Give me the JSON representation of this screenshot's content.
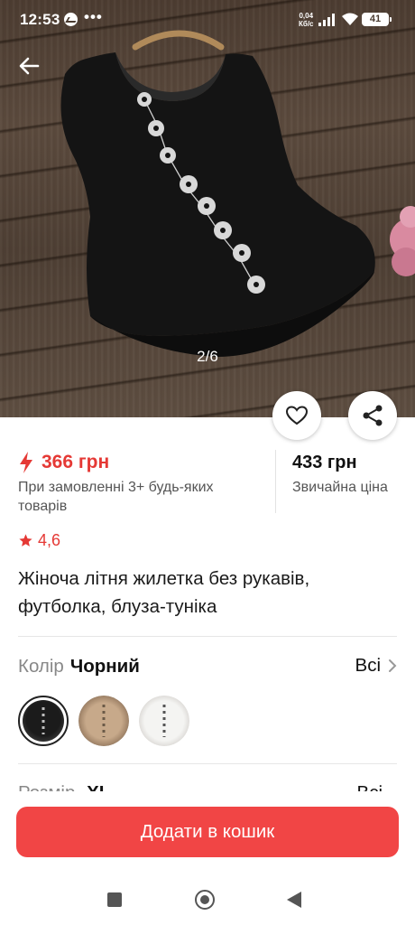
{
  "status_bar": {
    "time": "12:53",
    "dots": "•••",
    "network_speed_value": "0,04",
    "network_speed_unit": "Кб/с",
    "battery": "41",
    "icons": [
      "messenger-icon",
      "signal-icon",
      "wifi-icon",
      "battery-icon"
    ]
  },
  "gallery": {
    "counter": "2/6",
    "image_description_icon": "product-photo"
  },
  "actions": {
    "back_icon": "arrow-left-icon",
    "favorite_icon": "heart-icon",
    "share_icon": "share-icon"
  },
  "price": {
    "promo_price": "366 грн",
    "promo_condition": "При замовленні 3+ будь-яких товарів",
    "regular_price": "433 грн",
    "regular_label": "Звичайна ціна",
    "promo_color": "#e53935"
  },
  "rating": {
    "value": "4,6"
  },
  "product": {
    "title": "Жіноча літня жилетка без рукавів, футболка, блуза-туніка"
  },
  "color_option": {
    "label": "Колір",
    "value": "Чорний",
    "all_label": "Всі",
    "swatches": [
      {
        "name": "black",
        "color": "#1b1b1b",
        "selected": true
      },
      {
        "name": "beige",
        "color": "#c7a98a",
        "selected": false
      },
      {
        "name": "white",
        "color": "#f4f4f2",
        "selected": false
      }
    ]
  },
  "size_option": {
    "label": "Розмір",
    "value": "XL",
    "all_label": "Всі"
  },
  "cart": {
    "add_button": "Додати в кошик",
    "button_color": "#f14545"
  },
  "nav_bar": {
    "icons": [
      "recent-apps-icon",
      "home-icon",
      "back-triangle-icon"
    ]
  }
}
